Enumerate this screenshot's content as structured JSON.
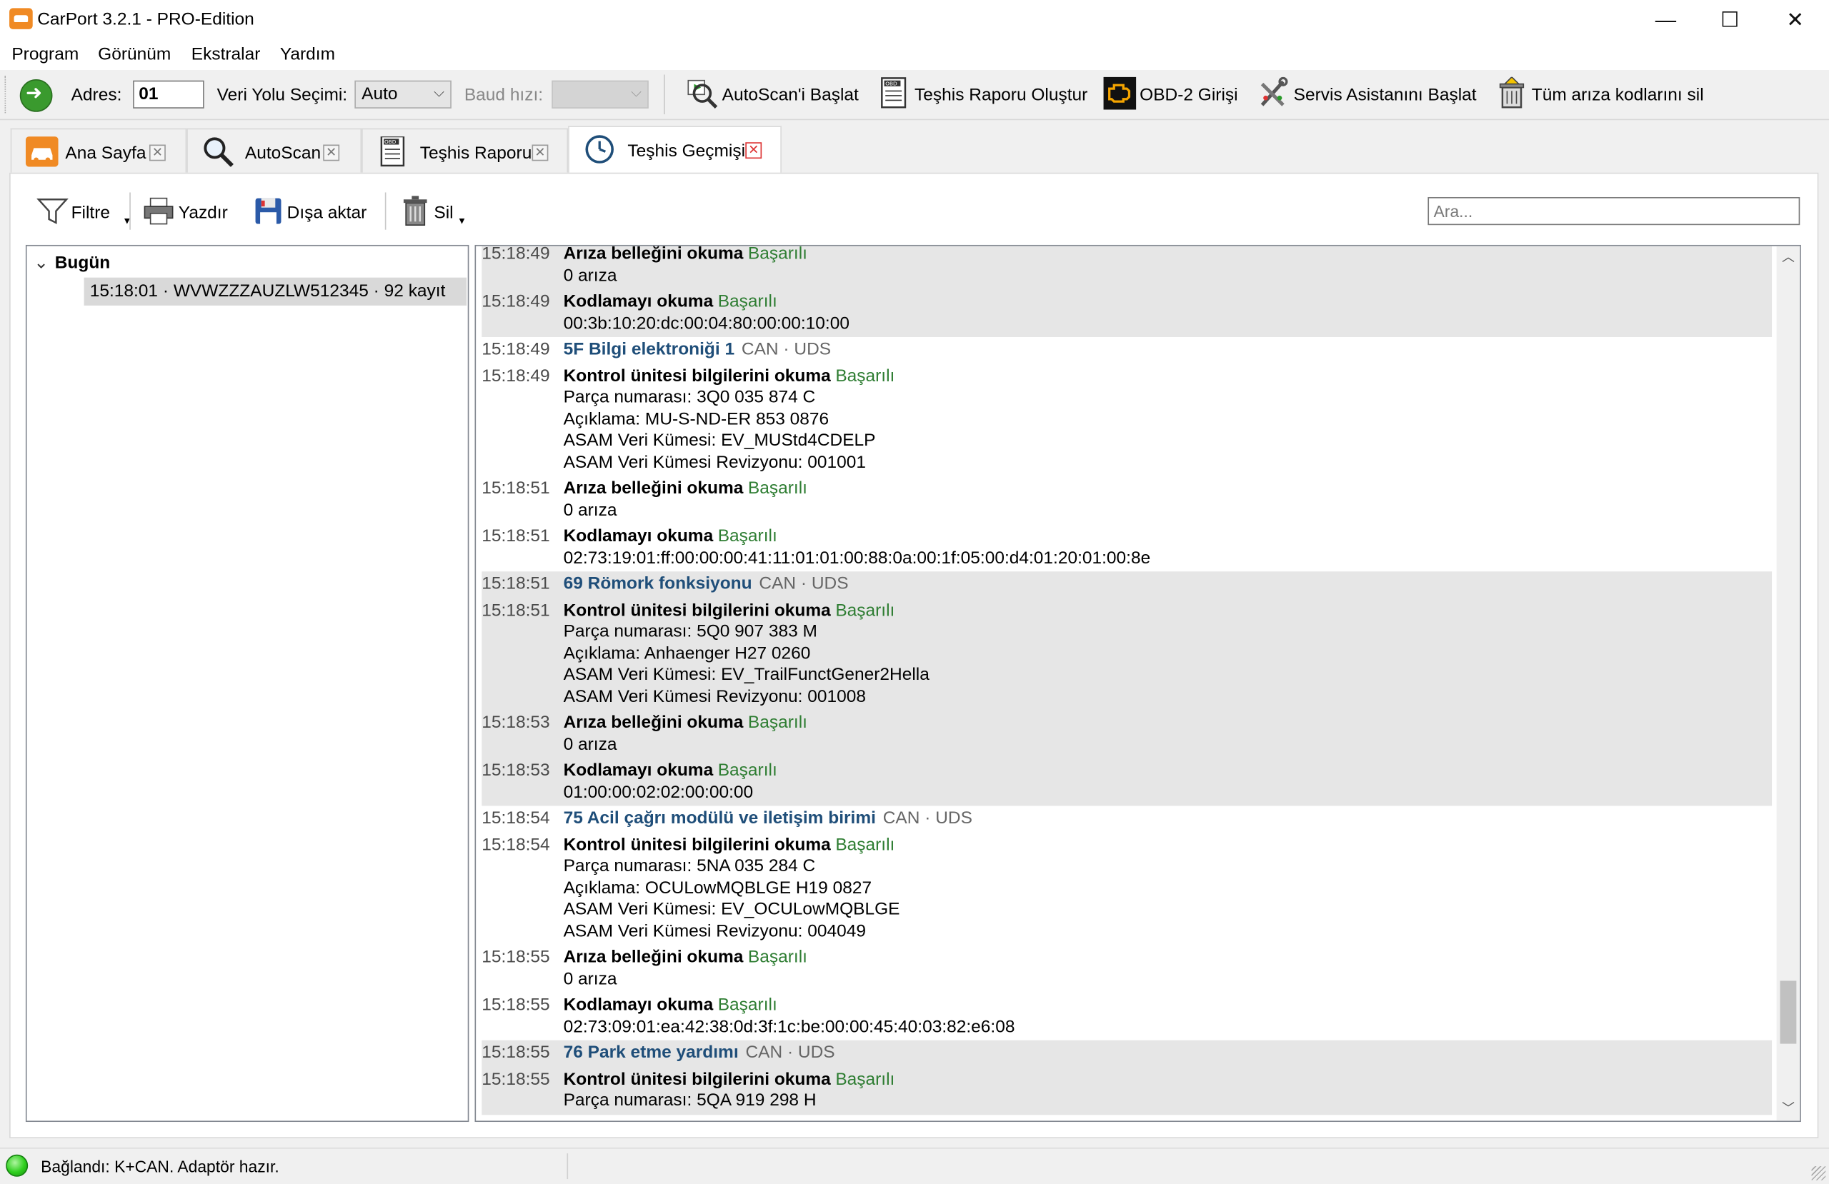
{
  "window": {
    "title": "CarPort 3.2.1 - PRO-Edition",
    "minimize": "—",
    "maximize": "☐",
    "close": "✕"
  },
  "menu": [
    "Program",
    "Görünüm",
    "Ekstralar",
    "Yardım"
  ],
  "toolbar": {
    "address_label": "Adres:",
    "address_value": "01",
    "bus_label": "Veri Yolu Seçimi:",
    "bus_value": "Auto",
    "baud_label": "Baud hızı:",
    "baud_value": "",
    "autoscan": "AutoScan'i Başlat",
    "report": "Teşhis Raporu Oluştur",
    "obd2": "OBD-2 Girişi",
    "service": "Servis Asistanını Başlat",
    "clear_all": "Tüm arıza kodlarını sil"
  },
  "tabs": [
    {
      "label": "Ana Sayfa",
      "icon": "car-icon"
    },
    {
      "label": "AutoScan",
      "icon": "magnifier-icon"
    },
    {
      "label": "Teşhis Raporu",
      "icon": "obd-report-icon"
    },
    {
      "label": "Teşhis Geçmişi",
      "icon": "clock-icon",
      "active": true
    }
  ],
  "content_toolbar": {
    "filter": "Filtre",
    "print": "Yazdır",
    "export": "Dışa aktar",
    "delete": "Sil",
    "search_placeholder": "Ara..."
  },
  "tree": {
    "root": "Bugün",
    "child": "15:18:01 · WVWZZZAUZLW512345 · 92 kayıt"
  },
  "log": {
    "ok": "Başarılı",
    "blocks": [
      {
        "gray": true,
        "rows": [
          {
            "time": "15:18:49",
            "kind": "op",
            "text": "Arıza belleğini okuma",
            "ok": true
          },
          {
            "kind": "detail",
            "text": "0 arıza"
          },
          {
            "time": "15:18:49",
            "kind": "op",
            "text": "Kodlamayı okuma",
            "ok": true
          },
          {
            "kind": "detail",
            "text": "00:3b:10:20:dc:00:04:80:00:00:10:00"
          }
        ]
      },
      {
        "gray": false,
        "rows": [
          {
            "time": "15:18:49",
            "kind": "hdr",
            "text": "5F Bilgi elektroniği 1",
            "proto": "CAN · UDS"
          },
          {
            "time": "15:18:49",
            "kind": "op",
            "text": "Kontrol ünitesi bilgilerini okuma",
            "ok": true
          },
          {
            "kind": "detail",
            "text": "Parça numarası: 3Q0 035 874 C"
          },
          {
            "kind": "detail",
            "text": "Açıklama: MU-S-ND-ER 853 0876"
          },
          {
            "kind": "detail",
            "text": "ASAM Veri Kümesi: EV_MUStd4CDELP"
          },
          {
            "kind": "detail",
            "text": "ASAM Veri Kümesi Revizyonu: 001001"
          },
          {
            "time": "15:18:51",
            "kind": "op",
            "text": "Arıza belleğini okuma",
            "ok": true
          },
          {
            "kind": "detail",
            "text": "0 arıza"
          },
          {
            "time": "15:18:51",
            "kind": "op",
            "text": "Kodlamayı okuma",
            "ok": true
          },
          {
            "kind": "detail",
            "text": "02:73:19:01:ff:00:00:00:41:11:01:01:00:88:0a:00:1f:05:00:d4:01:20:01:00:8e"
          }
        ]
      },
      {
        "gray": true,
        "rows": [
          {
            "time": "15:18:51",
            "kind": "hdr",
            "text": "69 Römork fonksiyonu",
            "proto": "CAN · UDS"
          },
          {
            "time": "15:18:51",
            "kind": "op",
            "text": "Kontrol ünitesi bilgilerini okuma",
            "ok": true
          },
          {
            "kind": "detail",
            "text": "Parça numarası: 5Q0 907 383 M"
          },
          {
            "kind": "detail",
            "text": "Açıklama: Anhaenger H27 0260"
          },
          {
            "kind": "detail",
            "text": "ASAM Veri Kümesi: EV_TrailFunctGener2Hella"
          },
          {
            "kind": "detail",
            "text": "ASAM Veri Kümesi Revizyonu: 001008"
          },
          {
            "time": "15:18:53",
            "kind": "op",
            "text": "Arıza belleğini okuma",
            "ok": true
          },
          {
            "kind": "detail",
            "text": "0 arıza"
          },
          {
            "time": "15:18:53",
            "kind": "op",
            "text": "Kodlamayı okuma",
            "ok": true
          },
          {
            "kind": "detail",
            "text": "01:00:00:02:02:00:00:00"
          }
        ]
      },
      {
        "gray": false,
        "rows": [
          {
            "time": "15:18:54",
            "kind": "hdr",
            "text": "75 Acil çağrı modülü ve iletişim birimi",
            "proto": "CAN · UDS"
          },
          {
            "time": "15:18:54",
            "kind": "op",
            "text": "Kontrol ünitesi bilgilerini okuma",
            "ok": true
          },
          {
            "kind": "detail",
            "text": "Parça numarası: 5NA 035 284 C"
          },
          {
            "kind": "detail",
            "text": "Açıklama: OCULowMQBLGE H19 0827"
          },
          {
            "kind": "detail",
            "text": "ASAM Veri Kümesi: EV_OCULowMQBLGE"
          },
          {
            "kind": "detail",
            "text": "ASAM Veri Kümesi Revizyonu: 004049"
          },
          {
            "time": "15:18:55",
            "kind": "op",
            "text": "Arıza belleğini okuma",
            "ok": true
          },
          {
            "kind": "detail",
            "text": "0 arıza"
          },
          {
            "time": "15:18:55",
            "kind": "op",
            "text": "Kodlamayı okuma",
            "ok": true
          },
          {
            "kind": "detail",
            "text": "02:73:09:01:ea:42:38:0d:3f:1c:be:00:00:45:40:03:82:e6:08"
          }
        ]
      },
      {
        "gray": true,
        "rows": [
          {
            "time": "15:18:55",
            "kind": "hdr",
            "text": "76 Park etme yardımı",
            "proto": "CAN · UDS"
          },
          {
            "time": "15:18:55",
            "kind": "op",
            "text": "Kontrol ünitesi bilgilerini okuma",
            "ok": true
          },
          {
            "kind": "detail",
            "text": "Parça numarası: 5QA 919 298 H"
          }
        ]
      }
    ]
  },
  "status": {
    "text": "Bağlandı: K+CAN. Adaptör hazır."
  }
}
